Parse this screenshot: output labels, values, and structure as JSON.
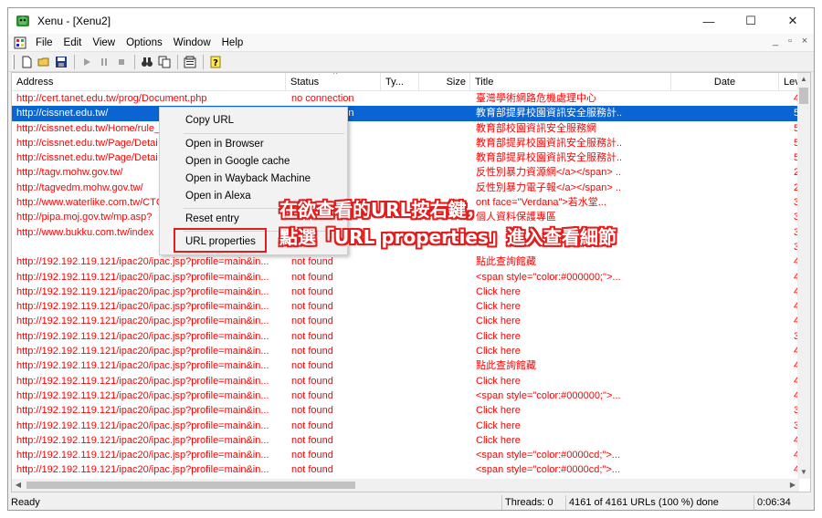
{
  "window": {
    "title": "Xenu - [Xenu2]",
    "controls": {
      "minimize": "—",
      "maximize": "☐",
      "close": "✕"
    }
  },
  "menubar": {
    "items": [
      "File",
      "Edit",
      "View",
      "Options",
      "Window",
      "Help"
    ],
    "mdi_controls": [
      "_",
      "▫",
      "×"
    ]
  },
  "columns": {
    "address": "Address",
    "status": "Status",
    "type": "Ty...",
    "size": "Size",
    "title": "Title",
    "date": "Date",
    "level": "Level"
  },
  "rows": [
    {
      "address": "http://cert.tanet.edu.tw/prog/Document.php",
      "status": "no connection",
      "title": "臺灣學術網路危機處理中心",
      "level": "4"
    },
    {
      "address": "http://cissnet.edu.tw/",
      "status": "no connection",
      "title": "教育部提昇校園資訊安全服務計...",
      "level": "5"
    },
    {
      "address": "http://cissnet.edu.tw/Home/rule_",
      "status": "",
      "title": "教育部校園資訊安全服務網",
      "level": "5"
    },
    {
      "address": "http://cissnet.edu.tw/Page/Detai",
      "status": "",
      "title": "教育部提昇校園資訊安全服務計...",
      "level": "5"
    },
    {
      "address": "http://cissnet.edu.tw/Page/Detai",
      "status": "",
      "title": "教育部提昇校園資訊安全服務計...",
      "level": "5"
    },
    {
      "address": "http://tagv.mohw.gov.tw/",
      "status": "",
      "title": "反性別暴力資源網</a></span> ...",
      "level": "2"
    },
    {
      "address": "http://tagvedm.mohw.gov.tw/",
      "status": "",
      "title": "反性別暴力電子報</a></span> ...",
      "level": "2"
    },
    {
      "address": "http://www.waterlike.com.tw/CTC",
      "status": "",
      "title": "ont face=\"Verdana\">若水堂...",
      "level": "3"
    },
    {
      "address": "http://pipa.moj.gov.tw/mp.asp?",
      "status": "",
      "title": "個人資料保護專區",
      "level": "3"
    },
    {
      "address": "http://www.bukku.com.tw/index",
      "status": "",
      "title": "",
      "level": "3"
    },
    {
      "address": "",
      "status": "",
      "title": "",
      "level": "3"
    },
    {
      "address": "http://192.192.119.121/ipac20/ipac.jsp?profile=main&in...",
      "status": "not found",
      "title": "點此查詢館藏",
      "level": "4"
    },
    {
      "address": "http://192.192.119.121/ipac20/ipac.jsp?profile=main&in...",
      "status": "not found",
      "title": "<span style=\"color:#000000;\">...",
      "level": "4"
    },
    {
      "address": "http://192.192.119.121/ipac20/ipac.jsp?profile=main&in...",
      "status": "not found",
      "title": "Click here",
      "level": "4"
    },
    {
      "address": "http://192.192.119.121/ipac20/ipac.jsp?profile=main&in...",
      "status": "not found",
      "title": "Click here",
      "level": "4"
    },
    {
      "address": "http://192.192.119.121/ipac20/ipac.jsp?profile=main&in...",
      "status": "not found",
      "title": "Click here",
      "level": "4"
    },
    {
      "address": "http://192.192.119.121/ipac20/ipac.jsp?profile=main&in...",
      "status": "not found",
      "title": "Click here",
      "level": "3"
    },
    {
      "address": "http://192.192.119.121/ipac20/ipac.jsp?profile=main&in...",
      "status": "not found",
      "title": "Click here",
      "level": "4"
    },
    {
      "address": "http://192.192.119.121/ipac20/ipac.jsp?profile=main&in...",
      "status": "not found",
      "title": "點此查詢館藏",
      "level": "4"
    },
    {
      "address": "http://192.192.119.121/ipac20/ipac.jsp?profile=main&in...",
      "status": "not found",
      "title": "Click here",
      "level": "4"
    },
    {
      "address": "http://192.192.119.121/ipac20/ipac.jsp?profile=main&in...",
      "status": "not found",
      "title": "<span style=\"color:#000000;\">...",
      "level": "4"
    },
    {
      "address": "http://192.192.119.121/ipac20/ipac.jsp?profile=main&in...",
      "status": "not found",
      "title": "Click here",
      "level": "3"
    },
    {
      "address": "http://192.192.119.121/ipac20/ipac.jsp?profile=main&in...",
      "status": "not found",
      "title": "Click here",
      "level": "3"
    },
    {
      "address": "http://192.192.119.121/ipac20/ipac.jsp?profile=main&in...",
      "status": "not found",
      "title": "Click here",
      "level": "4"
    },
    {
      "address": "http://192.192.119.121/ipac20/ipac.jsp?profile=main&in...",
      "status": "not found",
      "title": "<span style=\"color:#0000cd;\">...",
      "level": "4"
    },
    {
      "address": "http://192.192.119.121/ipac20/ipac.jsp?profile=main&in...",
      "status": "not found",
      "title": "<span style=\"color:#0000cd;\">...",
      "level": "4"
    }
  ],
  "selected_row": 1,
  "context_menu": {
    "items": [
      "Copy URL",
      "Open in Browser",
      "Open in Google cache",
      "Open in Wayback Machine",
      "Open in Alexa",
      "Reset entry",
      "URL properties"
    ]
  },
  "annotation": {
    "line1": "在欲查看的URL按右鍵，",
    "line2": "點選「URL properties」進入查看細節"
  },
  "statusbar": {
    "state": "Ready",
    "threads": "Threads: 0",
    "progress": "4161 of 4161 URLs (100 %) done",
    "elapsed": "0:06:34"
  },
  "colors": {
    "link_error": "#ff0000",
    "selection": "#0a64d2",
    "annotation": "#e31c1c"
  }
}
